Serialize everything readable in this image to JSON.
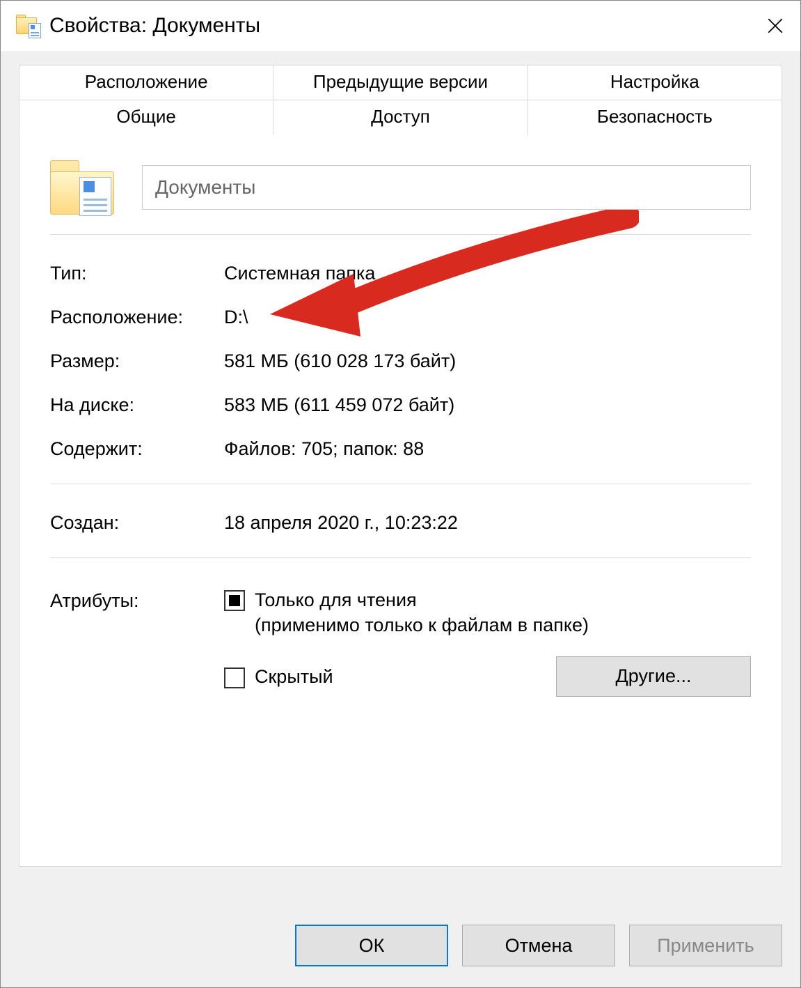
{
  "titlebar": {
    "title": "Свойства: Документы"
  },
  "tabs_top": [
    {
      "label": "Расположение"
    },
    {
      "label": "Предыдущие версии"
    },
    {
      "label": "Настройка"
    }
  ],
  "tabs_bottom": [
    {
      "label": "Общие"
    },
    {
      "label": "Доступ"
    },
    {
      "label": "Безопасность"
    }
  ],
  "general": {
    "name": "Документы",
    "type_label": "Тип:",
    "type_value": "Системная папка",
    "location_label": "Расположение:",
    "location_value": "D:\\",
    "size_label": "Размер:",
    "size_value": "581 МБ (610 028 173 байт)",
    "size_on_disk_label": "На диске:",
    "size_on_disk_value": "583 МБ (611 459 072 байт)",
    "contains_label": "Содержит:",
    "contains_value": "Файлов: 705; папок: 88",
    "created_label": "Создан:",
    "created_value": "18 апреля 2020 г., 10:23:22"
  },
  "attributes": {
    "title": "Атрибуты:",
    "readonly_label": "Только для чтения",
    "readonly_sub": "(применимо только к файлам в папке)",
    "hidden_label": "Скрытый",
    "other_button": "Другие..."
  },
  "footer": {
    "ok": "ОК",
    "cancel": "Отмена",
    "apply": "Применить"
  }
}
